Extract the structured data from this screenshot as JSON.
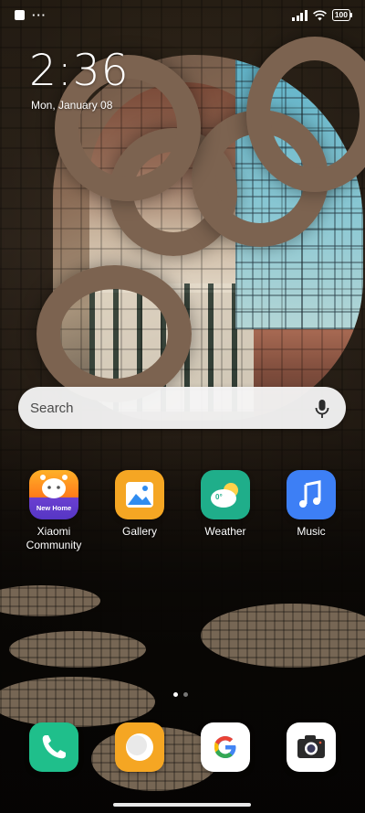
{
  "status_bar": {
    "notification_dots": "···",
    "battery_level": "100"
  },
  "clock": {
    "time": "2:36",
    "date": "Mon, January 08"
  },
  "search": {
    "placeholder": "Search"
  },
  "apps": [
    {
      "label": "Xiaomi\nCommunity",
      "icon": "xiaomi-community-icon",
      "badge": "New Home"
    },
    {
      "label": "Gallery",
      "icon": "gallery-icon"
    },
    {
      "label": "Weather",
      "icon": "weather-icon",
      "temp": "0°"
    },
    {
      "label": "Music",
      "icon": "music-icon"
    }
  ],
  "dock": [
    {
      "icon": "phone-icon"
    },
    {
      "icon": "messages-icon"
    },
    {
      "icon": "google-icon"
    },
    {
      "icon": "camera-icon"
    }
  ],
  "page_indicator": {
    "pages": 2,
    "active": 0
  },
  "colors": {
    "gallery": "#f5a623",
    "weather": "#1fae8a",
    "music": "#3d7ff5",
    "phone": "#1fbf8b",
    "messages": "#f5a623"
  }
}
